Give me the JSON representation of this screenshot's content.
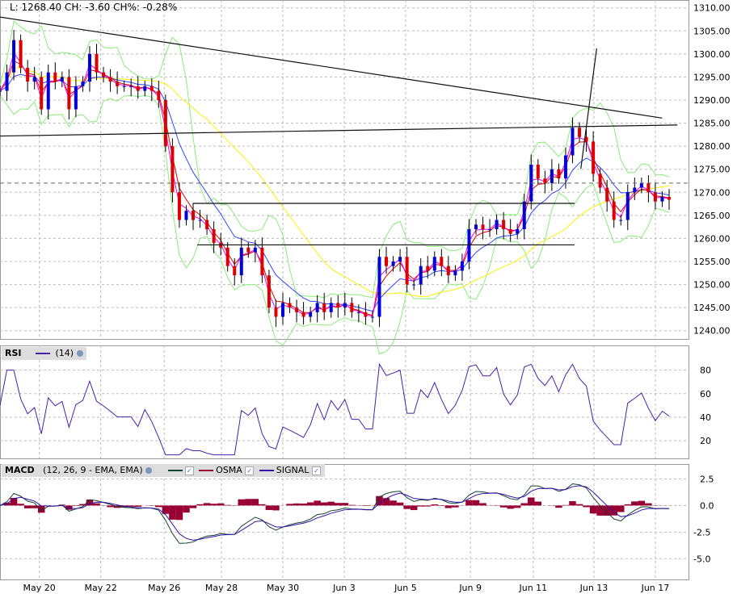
{
  "quote": "L: 1268.40 CH: -3.60 CH%: -0.28%",
  "rsi_panel": {
    "name": "RSI",
    "param": "(14)"
  },
  "macd_panel": {
    "name": "MACD",
    "param": "(12, 26, 9 - EMA, EMA)",
    "osma": "OSMA",
    "signal": "SIGNAL"
  },
  "colors": {
    "up": "#0000dd",
    "down": "#dd0000",
    "ema_fast": "#dd0000",
    "ema_mid": "#ee00ee",
    "ema_slow": "#3344ff",
    "sma_long": "#ffee00",
    "bands": "#88ee77",
    "rsi": "#4422aa",
    "macd": "#114433",
    "signal": "#3311aa",
    "osma": "#990033"
  },
  "chart_data": [
    {
      "type": "candlestick",
      "title": "Price",
      "ylim": [
        1235,
        1312
      ],
      "yticks": [
        1240,
        1245,
        1250,
        1255,
        1260,
        1265,
        1270,
        1275,
        1280,
        1285,
        1290,
        1295,
        1300,
        1305,
        1310
      ],
      "ytick_labels": [
        "1240.00",
        "1245.00",
        "1250.00",
        "1255.00",
        "1260.00",
        "1265.00",
        "1270.00",
        "1275.00",
        "1280.00",
        "1285.00",
        "1290.00",
        "1295.00",
        "1300.00",
        "1305.00",
        "1310.00"
      ],
      "xtick_labels": [
        "May 20",
        "May 22",
        "May 26",
        "May 28",
        "May 30",
        "Jun 3",
        "Jun 5",
        "Jun 9",
        "Jun 11",
        "Jun 13",
        "Jun 17"
      ],
      "xtick_index": [
        5.7,
        14.6,
        23.8,
        32.1,
        41,
        49.9,
        58.8,
        68.2,
        77.3,
        86.1,
        95
      ],
      "close": [
        1292,
        1296,
        1303,
        1297,
        1294,
        1295,
        1288,
        1296,
        1294,
        1295,
        1288,
        1293,
        1294,
        1300,
        1296,
        1295,
        1294,
        1293,
        1293,
        1293,
        1292,
        1293,
        1292,
        1290,
        1280,
        1270,
        1264,
        1266,
        1264,
        1264,
        1262,
        1259,
        1258,
        1254,
        1252,
        1258,
        1257,
        1258,
        1252,
        1245,
        1243,
        1246,
        1245,
        1244,
        1243,
        1244,
        1246,
        1244,
        1246,
        1245,
        1246,
        1244,
        1244,
        1243,
        1243,
        1256,
        1254,
        1255,
        1256,
        1250,
        1250,
        1254,
        1253,
        1256,
        1254,
        1252,
        1253,
        1255,
        1262,
        1263,
        1262,
        1262,
        1264,
        1262,
        1261,
        1262,
        1268,
        1276,
        1273,
        1272,
        1275,
        1273,
        1278,
        1284,
        1282,
        1281,
        1274,
        1271,
        1268,
        1264,
        1264,
        1270,
        1271,
        1272,
        1270,
        1268,
        1269,
        1268.4
      ],
      "last": 1268.4,
      "reference_level": 1272.0,
      "trendlines": [
        {
          "from": [
            0,
            1308
          ],
          "to": [
            96,
            1286.1
          ]
        },
        {
          "from": [
            0,
            1282.2
          ],
          "to": [
            98.2,
            1284.6
          ]
        },
        {
          "from": [
            28,
            1267.6
          ],
          "to": [
            83.3,
            1267.6
          ]
        },
        {
          "from": [
            28.6,
            1258.6
          ],
          "to": [
            83.3,
            1258.6
          ]
        },
        {
          "from": [
            84.2,
            1275.1
          ],
          "to": [
            86.5,
            1301.2
          ]
        }
      ]
    },
    {
      "type": "line",
      "title": "RSI",
      "ylim": [
        5,
        95
      ],
      "yticks": [
        20,
        40,
        60,
        80
      ],
      "ytick_labels": [
        "20",
        "40",
        "60",
        "80"
      ]
    },
    {
      "type": "line",
      "title": "MACD",
      "ylim": [
        -7,
        4
      ],
      "yticks": [
        -5,
        -2.5,
        0,
        2.5
      ],
      "ytick_labels": [
        "-5.0",
        "-2.5",
        "0.0",
        "2.5"
      ]
    }
  ]
}
